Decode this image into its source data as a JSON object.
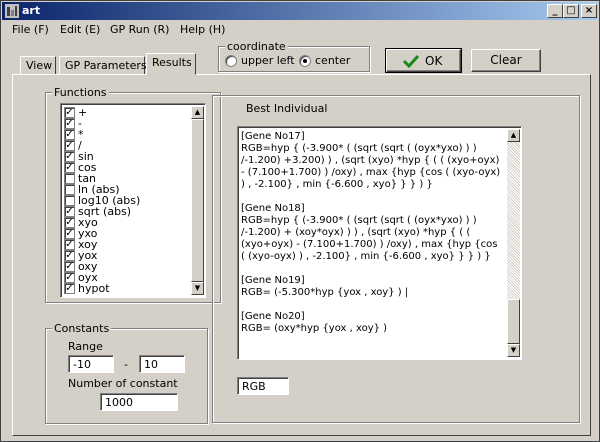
{
  "window": {
    "title": "art"
  },
  "menu": {
    "items": [
      "File (F)",
      "Edit (E)",
      "GP Run (R)",
      "Help (H)"
    ]
  },
  "tabs": [
    "View",
    "GP Parameters",
    "Results"
  ],
  "coordinate": {
    "label": "coordinate",
    "options": [
      "upper left",
      "center"
    ],
    "selected": "center"
  },
  "buttons": {
    "ok": "OK",
    "clear": "Clear"
  },
  "functions": {
    "label": "Functions",
    "items": [
      {
        "name": "+",
        "checked": true
      },
      {
        "name": "-",
        "checked": true
      },
      {
        "name": "*",
        "checked": true
      },
      {
        "name": "/",
        "checked": true
      },
      {
        "name": "sin",
        "checked": true
      },
      {
        "name": "cos",
        "checked": true
      },
      {
        "name": "tan",
        "checked": false
      },
      {
        "name": "ln (abs)",
        "checked": false
      },
      {
        "name": "log10 (abs)",
        "checked": false
      },
      {
        "name": "sqrt (abs)",
        "checked": true
      },
      {
        "name": "xyo",
        "checked": true
      },
      {
        "name": "yxo",
        "checked": true
      },
      {
        "name": "xoy",
        "checked": true
      },
      {
        "name": "yox",
        "checked": true
      },
      {
        "name": "oxy",
        "checked": true
      },
      {
        "name": "oyx",
        "checked": true
      },
      {
        "name": "hypot",
        "checked": true
      }
    ]
  },
  "constants": {
    "label": "Constants",
    "range_label": "Range",
    "range_min": "-10",
    "range_sep": "-",
    "range_max": "10",
    "count_label": "Number of constant",
    "count": "1000"
  },
  "best": {
    "label": "Best Individual",
    "text": "[Gene No17]\nRGB=hyp { (-3.900* ( (sqrt (sqrt ( (oyx*yxo) ) ) /-1.200) +3.200) ) , (sqrt (xyo) *hyp { ( ( (xyo+oyx) - (7.100+1.700) ) /oxy) , max {hyp {cos ( (xyo-oyx) ) , -2.100} , min {-6.600 , xyo} } } ) }\n\n[Gene No18]\nRGB=hyp { (-3.900* ( (sqrt (sqrt ( (oyx*yxo) ) ) /-1.200) + (xoy*oyx) ) ) , (sqrt (xyo) *hyp { ( ( (xyo+oyx) - (7.100+1.700) ) /oxy) , max {hyp {cos ( (xyo-oyx) ) , -2.100} , min {-6.600 , xyo} } } ) }\n\n[Gene No19]\nRGB= (-5.300*hyp {yox , xoy} ) |\n\n[Gene No20]\nRGB= (oxy*hyp {yox , xoy} )",
    "mode": "RGB"
  }
}
